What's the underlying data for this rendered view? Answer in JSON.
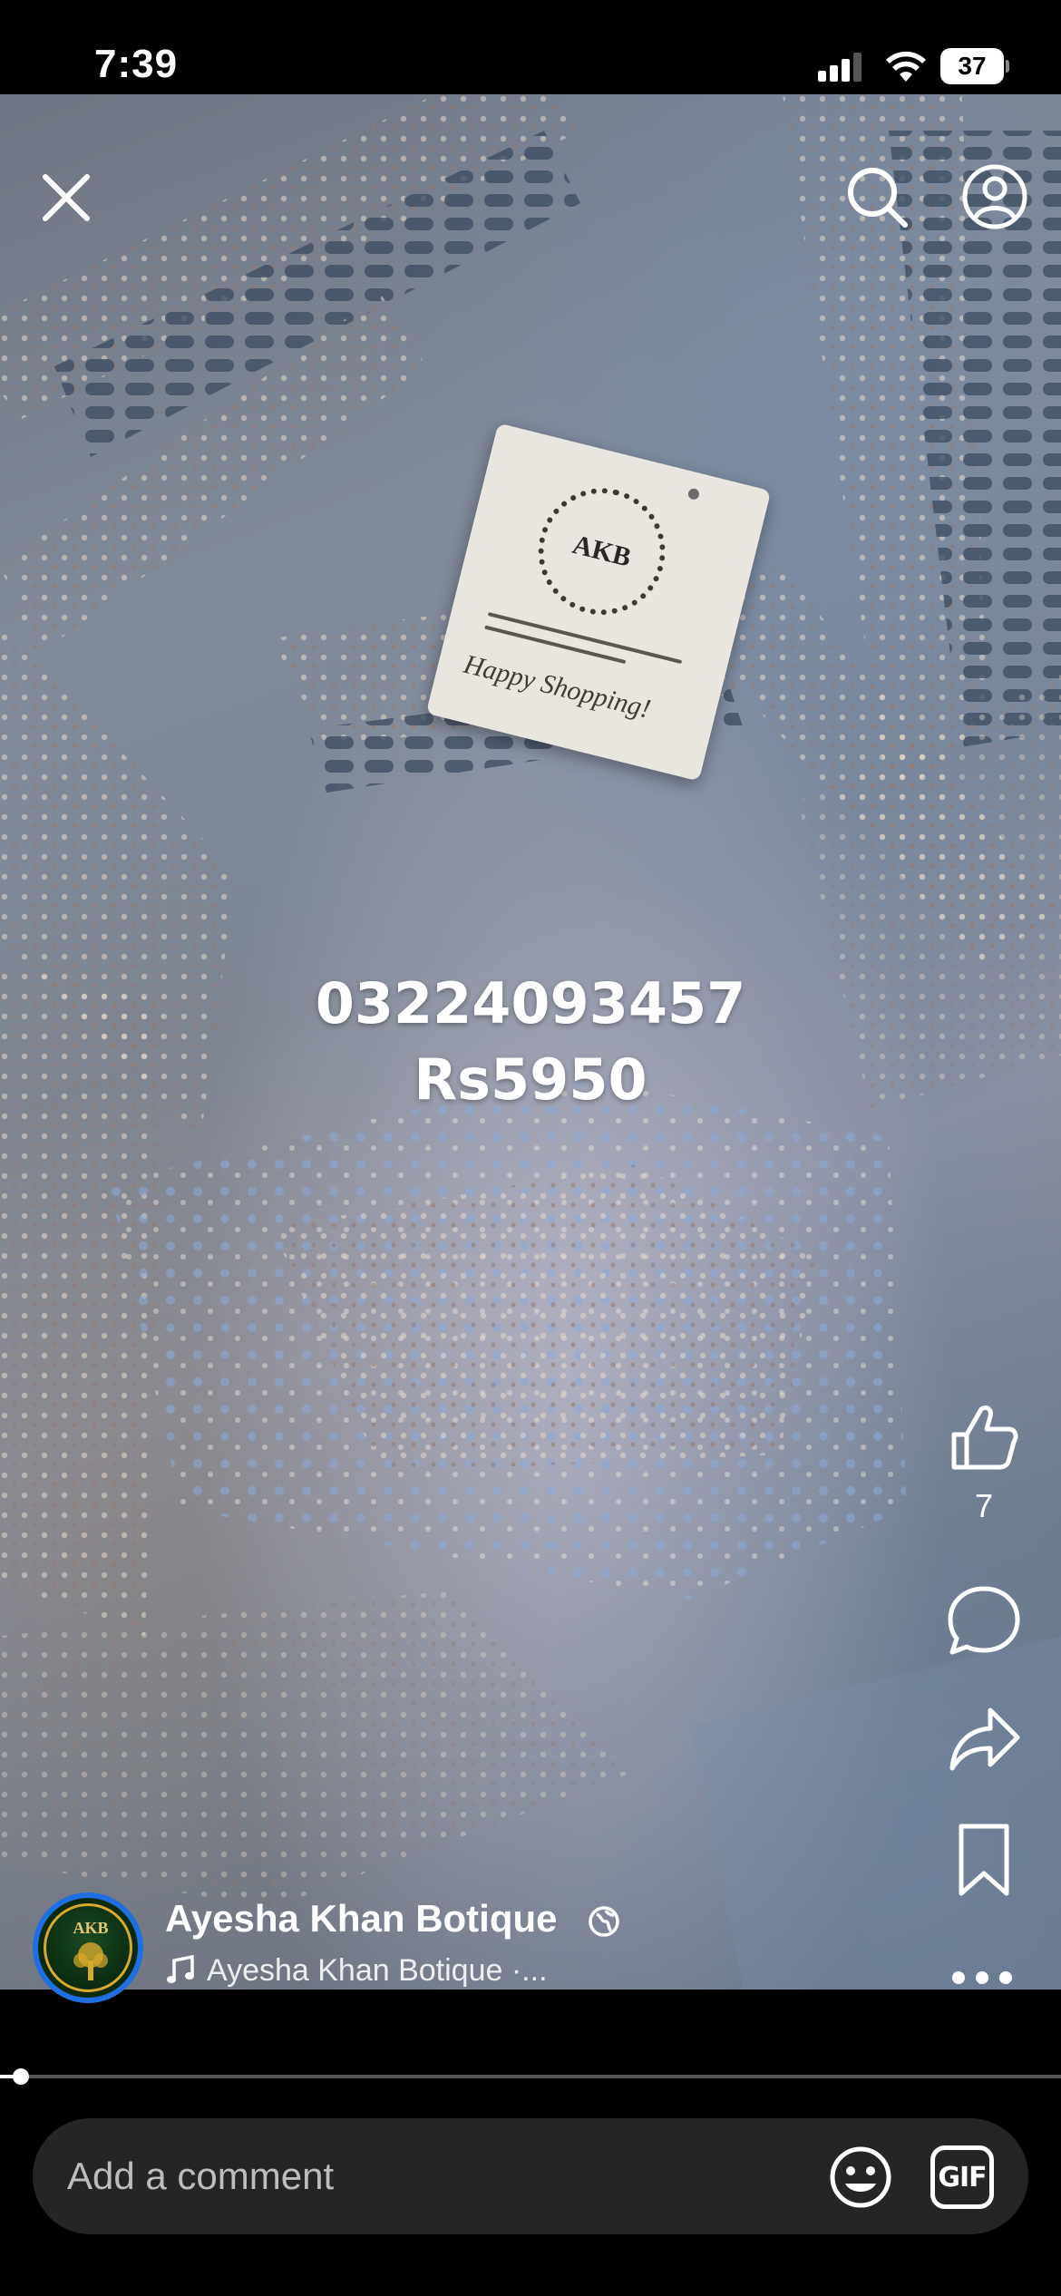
{
  "status_bar": {
    "time": "7:39",
    "battery_level": "37",
    "battery_fraction": 0.37
  },
  "video": {
    "phone_number": "03224093457",
    "price": "Rs5950",
    "tag": {
      "brand": "AKB",
      "slogan": "Happy Shopping!"
    }
  },
  "top_controls": {
    "close_icon": "close-icon",
    "search_icon": "search-icon",
    "profile_icon": "profile-icon"
  },
  "right_rail": {
    "like_count": "7",
    "icons": [
      "like-icon",
      "comment-icon",
      "share-icon",
      "bookmark-icon",
      "more-icon"
    ]
  },
  "author": {
    "name": "Ayesha Khan Botique",
    "avatar_text": "AKB",
    "audio": "Ayesha Khan Botique ·..."
  },
  "progress": {
    "fraction": 0.02
  },
  "comment_bar": {
    "placeholder": "Add a comment",
    "gif_label": "GIF"
  },
  "colors": {
    "avatar_ring": "#1f6fe0",
    "comment_bar_bg": "#252525"
  }
}
